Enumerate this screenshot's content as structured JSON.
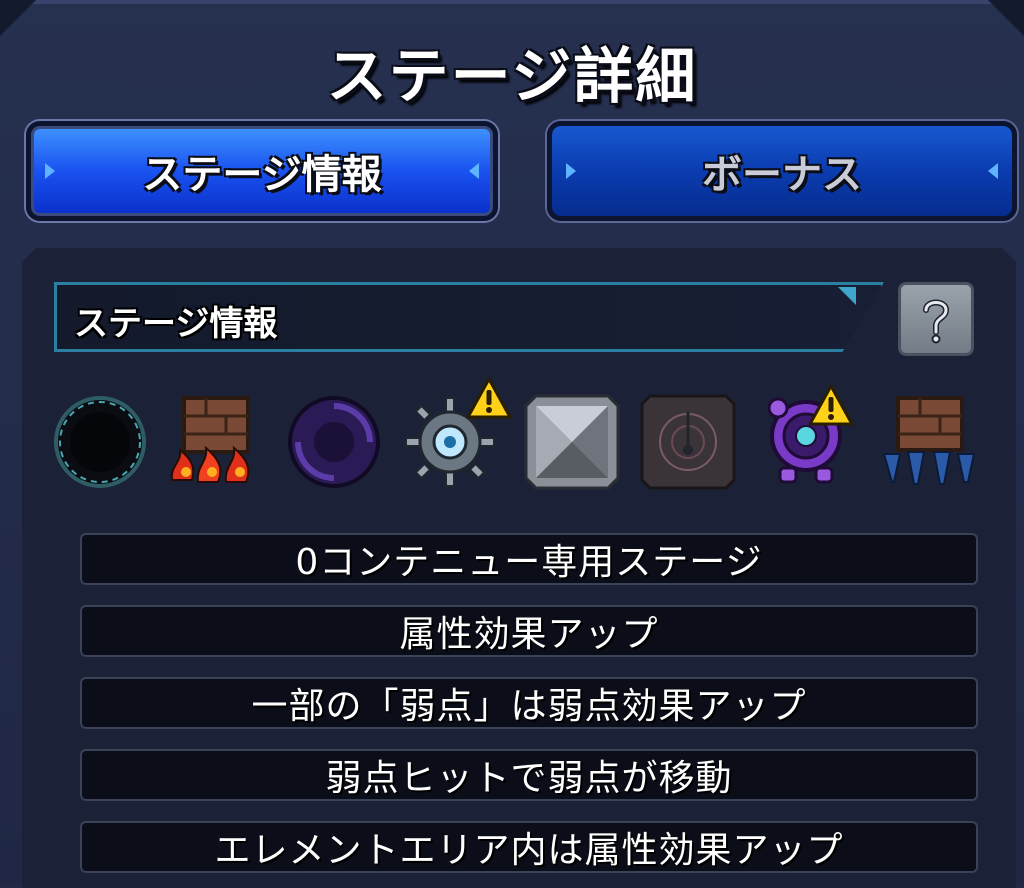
{
  "screen": {
    "title": "ステージ詳細"
  },
  "tabs": [
    {
      "label": "ステージ情報",
      "active": true
    },
    {
      "label": "ボーナス",
      "active": false
    }
  ],
  "section": {
    "title": "ステージ情報",
    "help_icon": "help-icon"
  },
  "gimmicks": [
    {
      "icon": "black-hole-icon"
    },
    {
      "icon": "damage-wall-fire-icon"
    },
    {
      "icon": "warp-portal-icon"
    },
    {
      "icon": "mine-eye-icon",
      "warning": true
    },
    {
      "icon": "metal-block-icon"
    },
    {
      "icon": "gravity-barrier-icon"
    },
    {
      "icon": "shield-robot-icon",
      "warning": true
    },
    {
      "icon": "damage-wall-down-icon"
    }
  ],
  "info_rows": [
    "0コンテニュー専用ステージ",
    "属性効果アップ",
    "一部の「弱点」は弱点効果アップ",
    "弱点ヒットで弱点が移動",
    "エレメントエリア内は属性効果アップ"
  ],
  "colors": {
    "accent_blue": "#1a52f0",
    "panel_bg": "#1b2238",
    "warning_yellow": "#ffd21a"
  }
}
